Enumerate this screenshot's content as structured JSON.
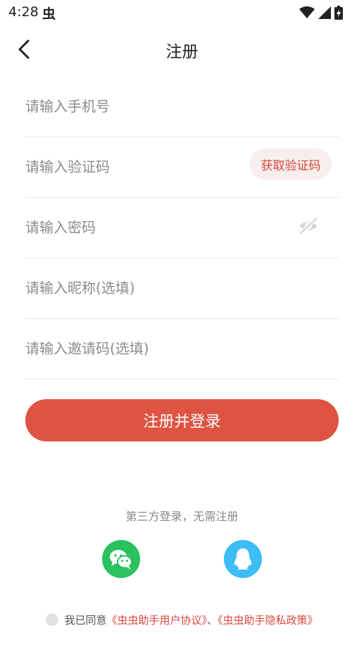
{
  "status_bar": {
    "time": "4:28",
    "app_icon_glyph": "虫"
  },
  "nav": {
    "title": "注册"
  },
  "form": {
    "phone_placeholder": "请输入手机号",
    "code_placeholder": "请输入验证码",
    "get_code_label": "获取验证码",
    "password_placeholder": "请输入密码",
    "nickname_placeholder": "请输入昵称(选填)",
    "invite_placeholder": "请输入邀请码(选填)",
    "submit_label": "注册并登录"
  },
  "third_party": {
    "label": "第三方登录，无需注册",
    "providers": [
      "wechat-icon",
      "qq-icon"
    ]
  },
  "agreement": {
    "prefix": "我已同意",
    "user_agreement": "《虫虫助手用户协议》",
    "separator": "、",
    "privacy_policy": "《虫虫助手隐私政策》"
  },
  "colors": {
    "accent": "#de5342",
    "link": "#d9473b",
    "wechat": "#2bc15f",
    "qq": "#3dbdf5"
  }
}
